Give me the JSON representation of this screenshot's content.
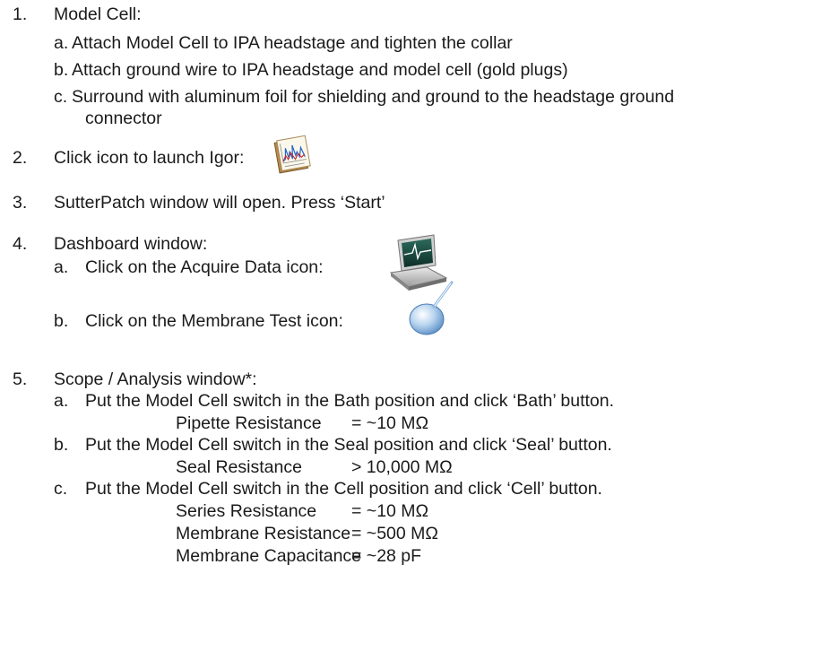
{
  "steps": [
    {
      "num": "1.",
      "text": "Model Cell:",
      "sub": [
        {
          "letter": "a.",
          "text": "Attach Model Cell to IPA headstage and tighten the collar"
        },
        {
          "letter": "b.",
          "text": "Attach ground wire to IPA headstage and model cell (gold plugs)"
        },
        {
          "letter": "c.",
          "text": "Surround with aluminum foil for shielding and ground to the headstage ground",
          "cont": "connector"
        }
      ]
    },
    {
      "num": "2.",
      "text": "Click icon to launch Igor:",
      "icon": "igor-app-icon"
    },
    {
      "num": "3.",
      "text": "SutterPatch window will open. Press ‘Start’"
    },
    {
      "num": "4.",
      "text": "Dashboard window:",
      "sub": [
        {
          "letter": "a.",
          "text": "Click on the Acquire Data icon:",
          "icon": "acquire-data-icon"
        },
        {
          "letter": "b.",
          "text": "Click on the Membrane Test icon:",
          "icon": "membrane-test-icon"
        }
      ]
    },
    {
      "num": "5.",
      "text": "Scope / Analysis window*:",
      "sub": [
        {
          "letter": "a.",
          "text": "Put the Model Cell switch in the Bath position and click ‘Bath’ button.",
          "rows": [
            {
              "label": "Pipette Resistance",
              "value": "= ~10 MΩ"
            }
          ]
        },
        {
          "letter": "b.",
          "text": "Put the Model Cell switch in the Seal position and click ‘Seal’ button.",
          "rows": [
            {
              "label": "Seal Resistance",
              "value": "> 10,000 MΩ"
            }
          ]
        },
        {
          "letter": "c.",
          "text": "Put the Model Cell switch in the Cell position and click ‘Cell’ button.",
          "rows": [
            {
              "label": "Series Resistance",
              "value": "= ~10 MΩ"
            },
            {
              "label": "Membrane Resistance",
              "value": "= ~500 MΩ"
            },
            {
              "label": "Membrane Capacitance",
              "value": "= ~28 pF"
            }
          ]
        }
      ]
    }
  ]
}
